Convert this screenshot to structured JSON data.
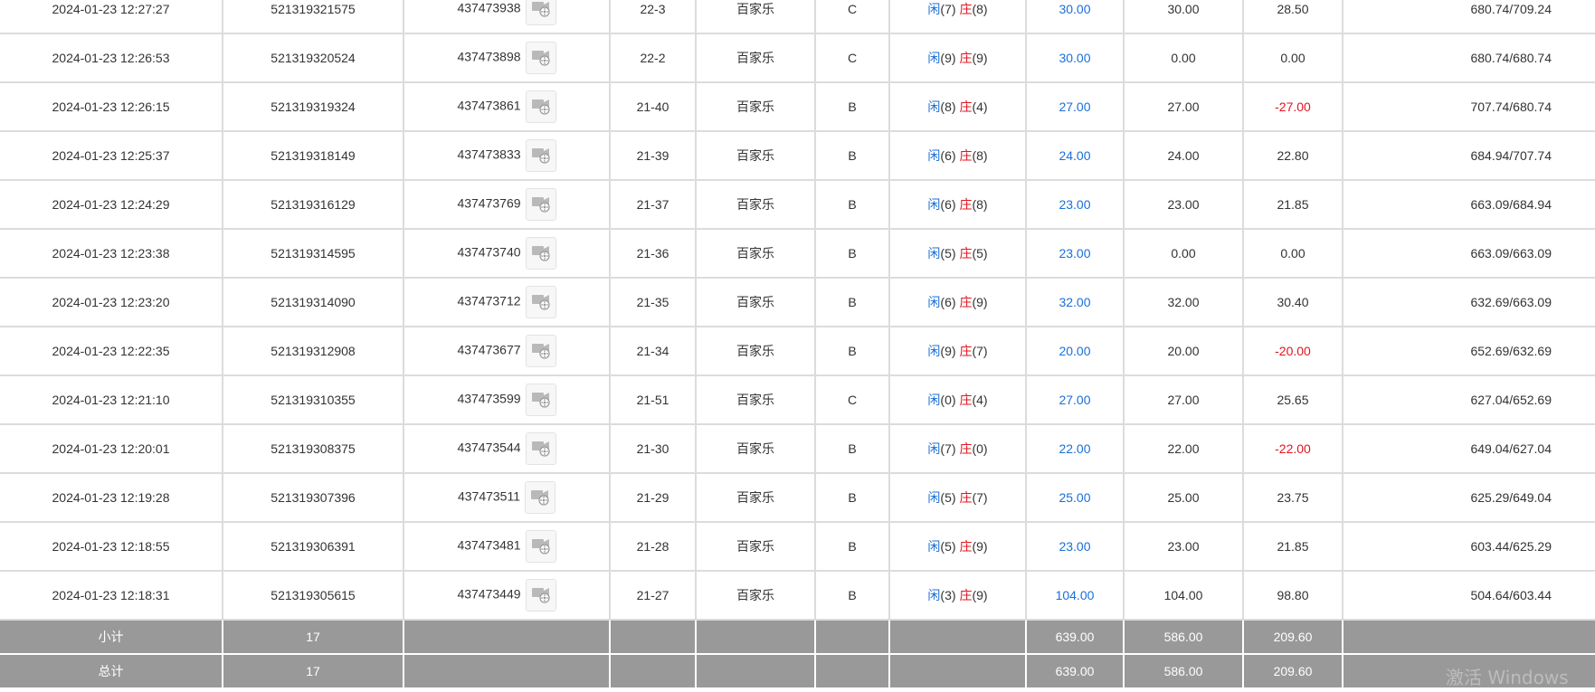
{
  "rows": [
    {
      "time": "2024-01-23 12:27:27",
      "order_no": "521319321575",
      "game_no": "437473938",
      "round": "22-3",
      "game": "百家乐",
      "table": "C",
      "player": "(7)",
      "banker": "(8)",
      "bet": "30.00",
      "valid": "30.00",
      "winloss": "28.50",
      "winloss_color": "normal",
      "balance": "680.74/709.24"
    },
    {
      "time": "2024-01-23 12:26:53",
      "order_no": "521319320524",
      "game_no": "437473898",
      "round": "22-2",
      "game": "百家乐",
      "table": "C",
      "player": "(9)",
      "banker": "(9)",
      "bet": "30.00",
      "valid": "0.00",
      "winloss": "0.00",
      "winloss_color": "normal",
      "balance": "680.74/680.74"
    },
    {
      "time": "2024-01-23 12:26:15",
      "order_no": "521319319324",
      "game_no": "437473861",
      "round": "21-40",
      "game": "百家乐",
      "table": "B",
      "player": "(8)",
      "banker": "(4)",
      "bet": "27.00",
      "valid": "27.00",
      "winloss": "-27.00",
      "winloss_color": "red",
      "balance": "707.74/680.74"
    },
    {
      "time": "2024-01-23 12:25:37",
      "order_no": "521319318149",
      "game_no": "437473833",
      "round": "21-39",
      "game": "百家乐",
      "table": "B",
      "player": "(6)",
      "banker": "(8)",
      "bet": "24.00",
      "valid": "24.00",
      "winloss": "22.80",
      "winloss_color": "normal",
      "balance": "684.94/707.74"
    },
    {
      "time": "2024-01-23 12:24:29",
      "order_no": "521319316129",
      "game_no": "437473769",
      "round": "21-37",
      "game": "百家乐",
      "table": "B",
      "player": "(6)",
      "banker": "(8)",
      "bet": "23.00",
      "valid": "23.00",
      "winloss": "21.85",
      "winloss_color": "normal",
      "balance": "663.09/684.94"
    },
    {
      "time": "2024-01-23 12:23:38",
      "order_no": "521319314595",
      "game_no": "437473740",
      "round": "21-36",
      "game": "百家乐",
      "table": "B",
      "player": "(5)",
      "banker": "(5)",
      "bet": "23.00",
      "valid": "0.00",
      "winloss": "0.00",
      "winloss_color": "normal",
      "balance": "663.09/663.09"
    },
    {
      "time": "2024-01-23 12:23:20",
      "order_no": "521319314090",
      "game_no": "437473712",
      "round": "21-35",
      "game": "百家乐",
      "table": "B",
      "player": "(6)",
      "banker": "(9)",
      "bet": "32.00",
      "valid": "32.00",
      "winloss": "30.40",
      "winloss_color": "normal",
      "balance": "632.69/663.09"
    },
    {
      "time": "2024-01-23 12:22:35",
      "order_no": "521319312908",
      "game_no": "437473677",
      "round": "21-34",
      "game": "百家乐",
      "table": "B",
      "player": "(9)",
      "banker": "(7)",
      "bet": "20.00",
      "valid": "20.00",
      "winloss": "-20.00",
      "winloss_color": "red",
      "balance": "652.69/632.69"
    },
    {
      "time": "2024-01-23 12:21:10",
      "order_no": "521319310355",
      "game_no": "437473599",
      "round": "21-51",
      "game": "百家乐",
      "table": "C",
      "player": "(0)",
      "banker": "(4)",
      "bet": "27.00",
      "valid": "27.00",
      "winloss": "25.65",
      "winloss_color": "normal",
      "balance": "627.04/652.69"
    },
    {
      "time": "2024-01-23 12:20:01",
      "order_no": "521319308375",
      "game_no": "437473544",
      "round": "21-30",
      "game": "百家乐",
      "table": "B",
      "player": "(7)",
      "banker": "(0)",
      "bet": "22.00",
      "valid": "22.00",
      "winloss": "-22.00",
      "winloss_color": "red",
      "balance": "649.04/627.04"
    },
    {
      "time": "2024-01-23 12:19:28",
      "order_no": "521319307396",
      "game_no": "437473511",
      "round": "21-29",
      "game": "百家乐",
      "table": "B",
      "player": "(5)",
      "banker": "(7)",
      "bet": "25.00",
      "valid": "25.00",
      "winloss": "23.75",
      "winloss_color": "normal",
      "balance": "625.29/649.04"
    },
    {
      "time": "2024-01-23 12:18:55",
      "order_no": "521319306391",
      "game_no": "437473481",
      "round": "21-28",
      "game": "百家乐",
      "table": "B",
      "player": "(5)",
      "banker": "(9)",
      "bet": "23.00",
      "valid": "23.00",
      "winloss": "21.85",
      "winloss_color": "normal",
      "balance": "603.44/625.29"
    },
    {
      "time": "2024-01-23 12:18:31",
      "order_no": "521319305615",
      "game_no": "437473449",
      "round": "21-27",
      "game": "百家乐",
      "table": "B",
      "player": "(3)",
      "banker": "(9)",
      "bet": "104.00",
      "valid": "104.00",
      "winloss": "98.80",
      "winloss_color": "normal",
      "balance": "504.64/603.44"
    }
  ],
  "labels": {
    "player": "闲",
    "banker": "庄"
  },
  "subtotal": {
    "label": "小计",
    "count": "17",
    "bet": "639.00",
    "valid": "586.00",
    "winloss": "209.60"
  },
  "total": {
    "label": "总计",
    "count": "17",
    "bet": "639.00",
    "valid": "586.00",
    "winloss": "209.60"
  },
  "icons": {
    "game_detail": "video-replay-icon"
  },
  "colors": {
    "accent_blue": "#1a6fd6",
    "loss_red": "#e0151f",
    "summary_bg": "#999999",
    "grid": "#dcdcdc"
  },
  "watermark": "激活 Windows"
}
